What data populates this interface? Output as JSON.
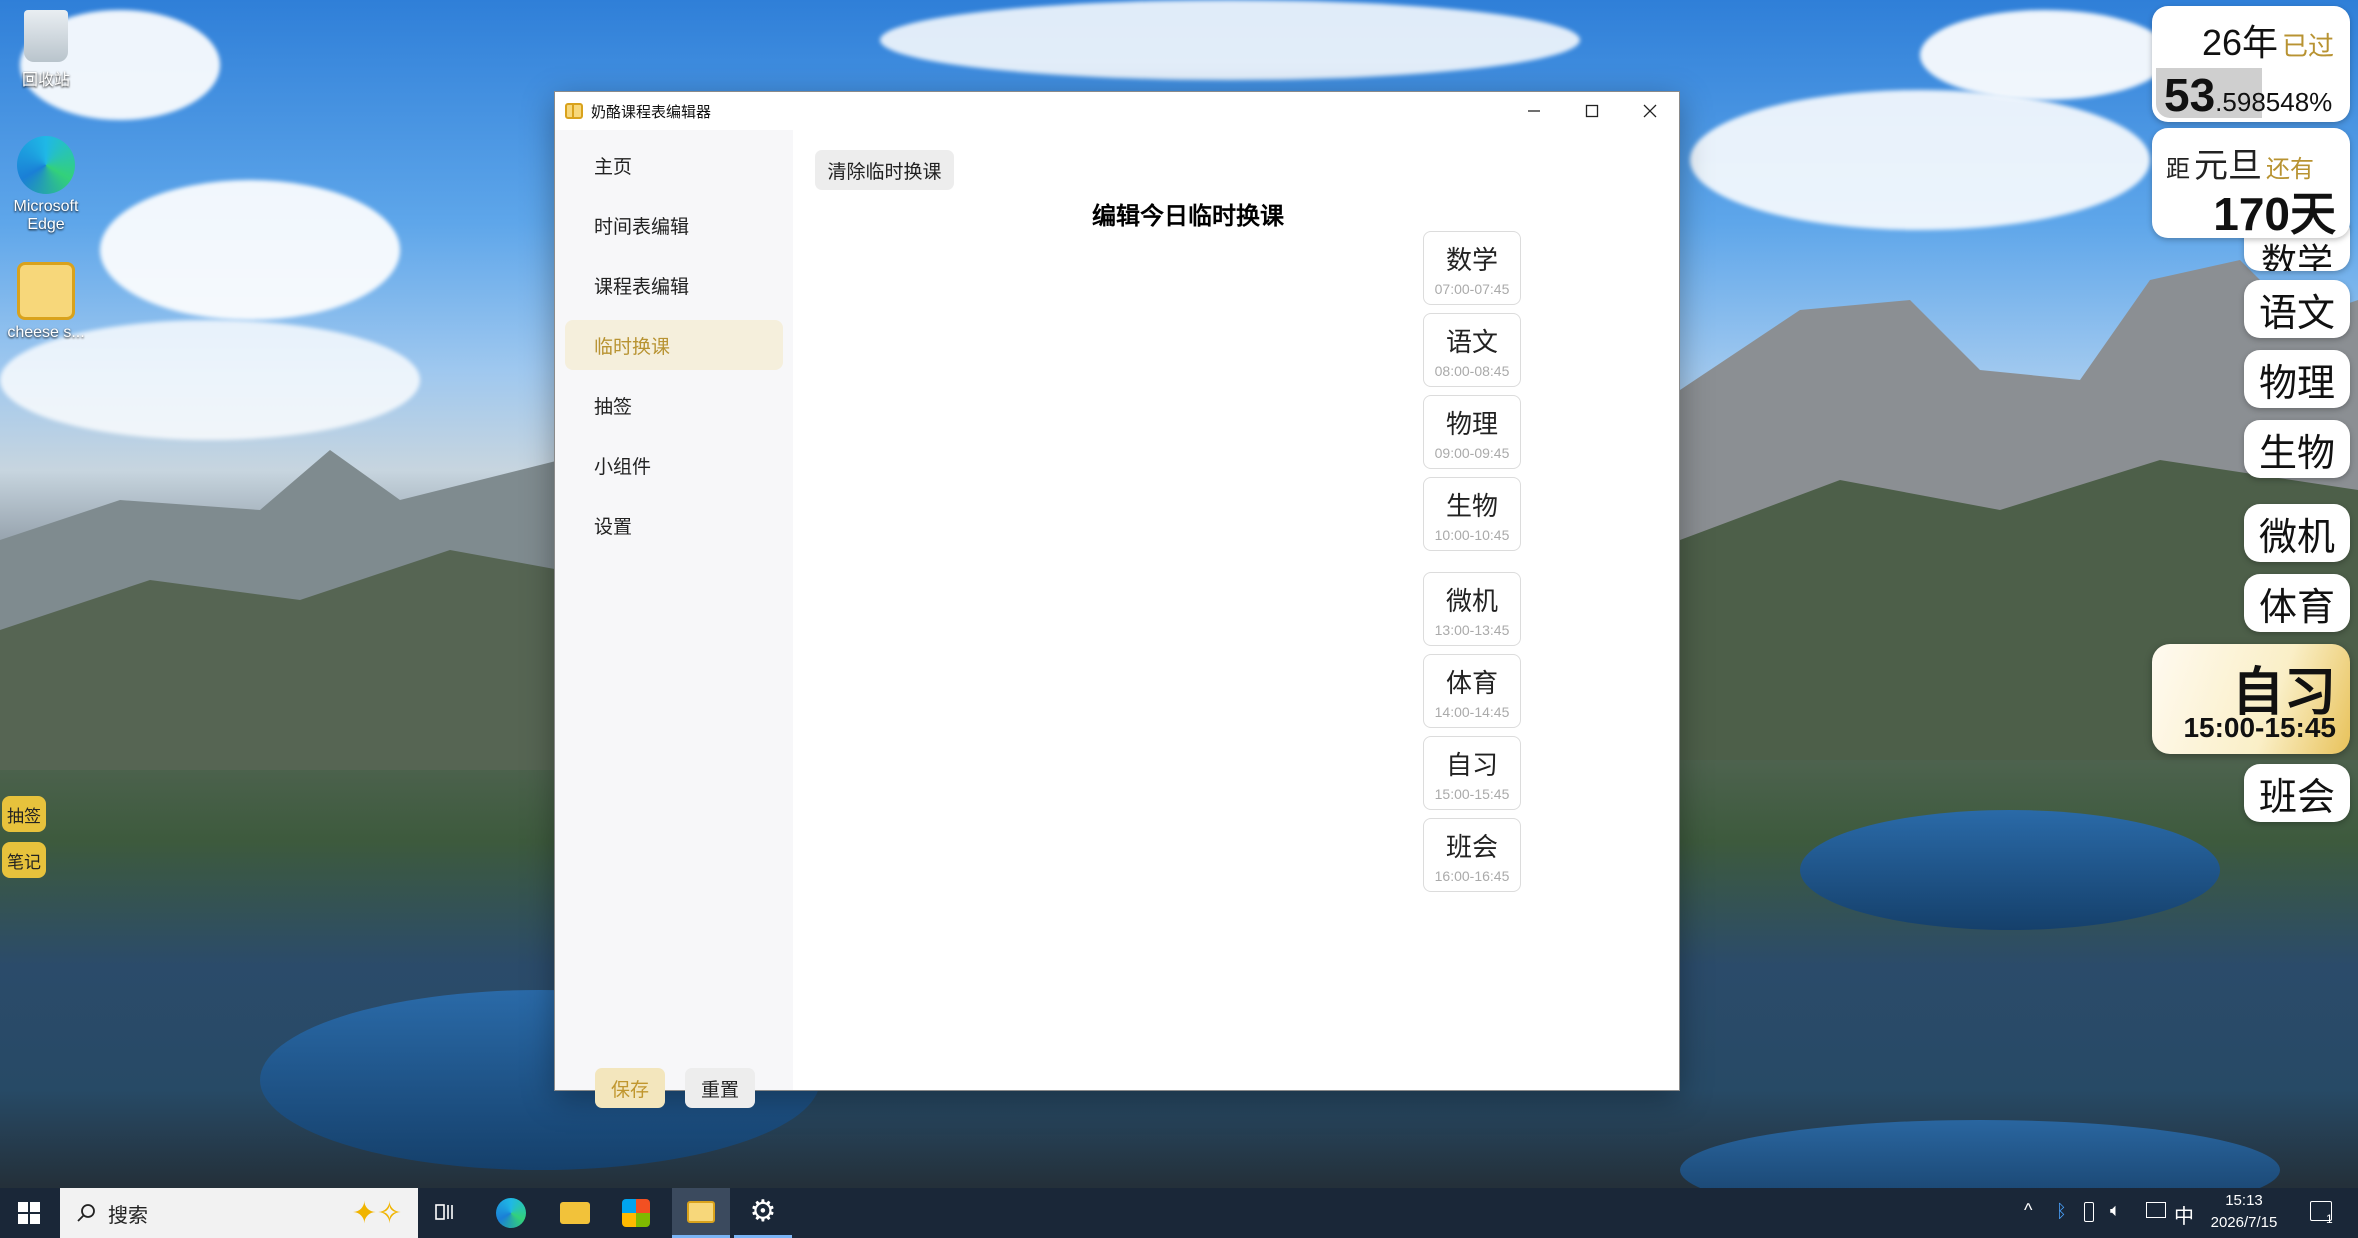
{
  "desktop": {
    "icons": [
      {
        "label": "回收站"
      },
      {
        "label": "Microsoft Edge"
      },
      {
        "label": "cheese s..."
      }
    ],
    "side_buttons": [
      "抽签",
      "笔记"
    ]
  },
  "window": {
    "title": "奶酪课程表编辑器",
    "nav": [
      "主页",
      "时间表编辑",
      "课程表编辑",
      "临时换课",
      "抽签",
      "小组件",
      "设置"
    ],
    "active_nav": "临时换课",
    "save_label": "保存",
    "reset_label": "重置",
    "clear_label": "清除临时换课",
    "heading": "编辑今日临时换课",
    "courses": [
      {
        "name": "数学",
        "time": "07:00-07:45"
      },
      {
        "name": "语文",
        "time": "08:00-08:45"
      },
      {
        "name": "物理",
        "time": "09:00-09:45"
      },
      {
        "name": "生物",
        "time": "10:00-10:45"
      },
      {
        "name": "微机",
        "time": "13:00-13:45"
      },
      {
        "name": "体育",
        "time": "14:00-14:45"
      },
      {
        "name": "自习",
        "time": "15:00-15:45"
      },
      {
        "name": "班会",
        "time": "16:00-16:45"
      }
    ]
  },
  "widgets": {
    "year_progress": {
      "year": "26年",
      "suffix": "已过",
      "int": "53",
      "frac": ".598548%"
    },
    "countdown": {
      "prefix": "距",
      "event": "元旦",
      "suffix": "还有",
      "value": "170天"
    },
    "partial_top": "数学",
    "schedule": [
      "语文",
      "物理",
      "生物",
      "微机",
      "体育"
    ],
    "current": {
      "name": "自习",
      "time": "15:00-15:45"
    },
    "next": "班会"
  },
  "taskbar": {
    "search_placeholder": "搜索",
    "ime": "中",
    "time": "15:13",
    "date": "2026/7/15",
    "notif_count": "1"
  }
}
